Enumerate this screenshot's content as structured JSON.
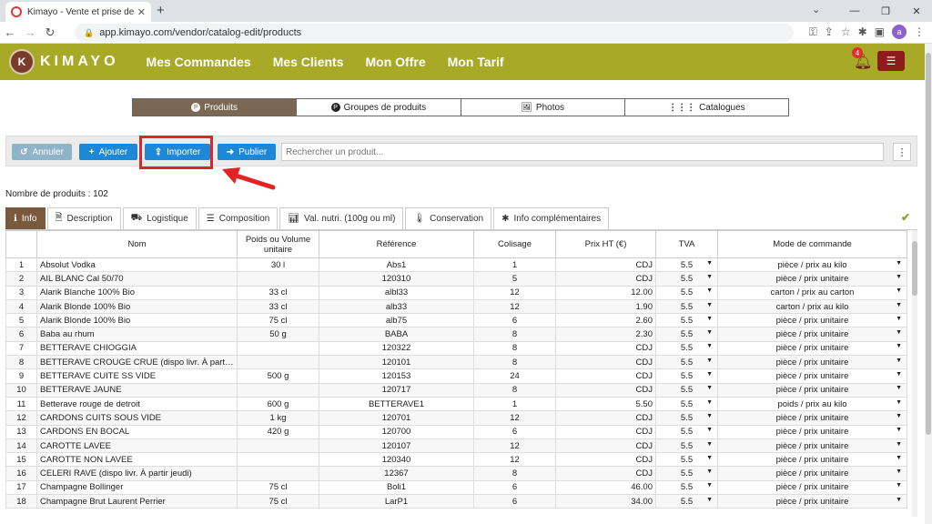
{
  "browser": {
    "tab_title": "Kimayo - Vente et prise de comm",
    "url": "app.kimayo.com/vendor/catalog-edit/products",
    "avatar_letter": "a"
  },
  "header": {
    "logo_text": "KIMAYO",
    "menu": [
      "Mes Commandes",
      "Mes Clients",
      "Mon Offre",
      "Mon Tarif"
    ],
    "notification_count": "4"
  },
  "section_tabs": [
    {
      "label": "Produits",
      "active": true
    },
    {
      "label": "Groupes de produits",
      "active": false
    },
    {
      "label": "Photos",
      "active": false
    },
    {
      "label": "Catalogues",
      "active": false
    }
  ],
  "toolbar": {
    "cancel_label": "Annuler",
    "add_label": "Ajouter",
    "import_label": "Importer",
    "publish_label": "Publier",
    "search_placeholder": "Rechercher un produit..."
  },
  "product_count": "Nombre de produits : 102",
  "sub_tabs": [
    {
      "label": "Info",
      "active": true
    },
    {
      "label": "Description",
      "active": false
    },
    {
      "label": "Logistique",
      "active": false
    },
    {
      "label": "Composition",
      "active": false
    },
    {
      "label": "Val. nutri. (100g ou ml)",
      "active": false
    },
    {
      "label": "Conservation",
      "active": false
    },
    {
      "label": "Info complémentaires",
      "active": false
    }
  ],
  "table": {
    "headers": [
      "",
      "Nom",
      "Poids ou Volume unitaire",
      "Référence",
      "Colisage",
      "Prix HT (€)",
      "TVA",
      "Mode de commande"
    ],
    "rows": [
      [
        "1",
        "Absolut Vodka",
        "30 l",
        "Abs1",
        "1",
        "CDJ",
        "5.5",
        "pièce / prix au kilo"
      ],
      [
        "2",
        "AIL BLANC Cal 50/70",
        "",
        "120310",
        "5",
        "CDJ",
        "5.5",
        "pièce / prix unitaire"
      ],
      [
        "3",
        "Alarik Blanche 100% Bio",
        "33 cl",
        "albl33",
        "12",
        "12.00",
        "5.5",
        "carton / prix au carton"
      ],
      [
        "4",
        "Alarik Blonde 100% Bio",
        "33 cl",
        "alb33",
        "12",
        "1.90",
        "5.5",
        "carton / prix au kilo"
      ],
      [
        "5",
        "Alarik Blonde 100% Bio",
        "75 cl",
        "alb75",
        "6",
        "2.60",
        "5.5",
        "pièce / prix unitaire"
      ],
      [
        "6",
        "Baba au rhum",
        "50 g",
        "BABA",
        "8",
        "2.30",
        "5.5",
        "pièce / prix unitaire"
      ],
      [
        "7",
        "BETTERAVE CHIOGGIA",
        "",
        "120322",
        "8",
        "CDJ",
        "5.5",
        "pièce / prix unitaire"
      ],
      [
        "8",
        "BETTERAVE CROUGE CRUE (dispo livr. À partir jeudi)",
        "",
        "120101",
        "8",
        "CDJ",
        "5.5",
        "pièce / prix unitaire"
      ],
      [
        "9",
        "BETTERAVE CUITE SS VIDE",
        "500 g",
        "120153",
        "24",
        "CDJ",
        "5.5",
        "pièce / prix unitaire"
      ],
      [
        "10",
        "BETTERAVE JAUNE",
        "",
        "120717",
        "8",
        "CDJ",
        "5.5",
        "pièce / prix unitaire"
      ],
      [
        "11",
        "Betterave rouge de detroit",
        "600 g",
        "BETTERAVE1",
        "1",
        "5.50",
        "5.5",
        "poids / prix au kilo"
      ],
      [
        "12",
        "CARDONS CUITS SOUS VIDE",
        "1 kg",
        "120701",
        "12",
        "CDJ",
        "5.5",
        "pièce / prix unitaire"
      ],
      [
        "13",
        "CARDONS EN BOCAL",
        "420 g",
        "120700",
        "6",
        "CDJ",
        "5.5",
        "pièce / prix unitaire"
      ],
      [
        "14",
        "CAROTTE LAVEE",
        "",
        "120107",
        "12",
        "CDJ",
        "5.5",
        "pièce / prix unitaire"
      ],
      [
        "15",
        "CAROTTE NON LAVEE",
        "",
        "120340",
        "12",
        "CDJ",
        "5.5",
        "pièce / prix unitaire"
      ],
      [
        "16",
        "CELERI RAVE (dispo livr. À partir jeudi)",
        "",
        "12367",
        "8",
        "CDJ",
        "5.5",
        "pièce / prix unitaire"
      ],
      [
        "17",
        "Champagne Bollinger",
        "75 cl",
        "Boli1",
        "6",
        "46.00",
        "5.5",
        "pièce / prix unitaire"
      ],
      [
        "18",
        "Champagne Brut Laurent Perrier",
        "75 cl",
        "LarP1",
        "6",
        "34.00",
        "5.5",
        "pièce / prix unitaire"
      ]
    ]
  },
  "colors": {
    "header_bg": "#a9a928",
    "active_tab": "#7a6855",
    "button_blue": "#1e88d8",
    "cancel_gray": "#8fb3c9",
    "highlight_red": "#e12424"
  }
}
